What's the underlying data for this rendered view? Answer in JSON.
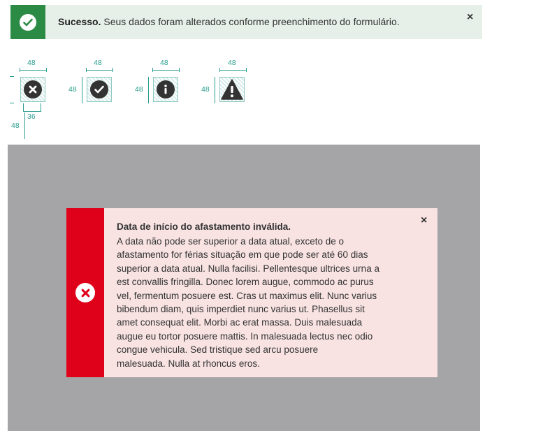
{
  "success": {
    "title": "Sucesso.",
    "message": "Seus dados foram alterados conforme preenchimento do formulário.",
    "close_label": "×",
    "icon": "check-circle-icon",
    "bar_color": "#2b8b45",
    "bg_color": "#e6f0e9"
  },
  "spec": {
    "size_label": "48",
    "inner_label": "36",
    "icons": [
      "error-icon",
      "success-icon",
      "info-icon",
      "warning-icon"
    ],
    "accent_color": "#2a9d8f"
  },
  "error": {
    "title": "Data de início do afastamento inválida.",
    "lines": [
      "A data não pode ser superior a data atual, exceto de o",
      "afastamento for férias situação em que pode ser até 60 dias",
      "superior a data atual. Nulla facilisi. Pellentesque ultrices urna a",
      "est convallis fringilla. Donec lorem augue, commodo ac purus",
      "vel, fermentum posuere est. Cras ut maximus elit. Nunc varius",
      "bibendum diam, quis imperdiet nunc varius ut. Phasellus sit",
      "amet consequat elit. Morbi ac erat massa. Duis malesuada",
      "augue eu tortor posuere mattis. In malesuada lectus nec odio",
      "congue vehicula. Sed tristique sed arcu posuere",
      "malesuada. Nulla at rhoncus eros."
    ],
    "close_label": "×",
    "icon": "x-circle-icon",
    "bar_color": "#df001a",
    "bg_color": "#f8e2e2"
  },
  "overlay_color": "#a5a5a7"
}
